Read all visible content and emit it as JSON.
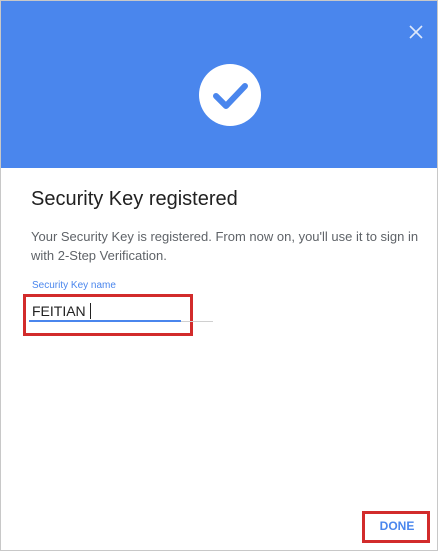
{
  "dialog": {
    "title": "Security Key registered",
    "description": "Your Security Key is registered. From now on, you'll use it to sign in with 2-Step Verification.",
    "close_icon": "close-icon",
    "success_icon": "check-circle-icon",
    "header_color": "#4a86ed",
    "accent_color": "#4a86ed",
    "highlight_color": "#d22b2b"
  },
  "field": {
    "label": "Security Key name",
    "value": "FEITIAN"
  },
  "actions": {
    "done_label": "DONE"
  }
}
